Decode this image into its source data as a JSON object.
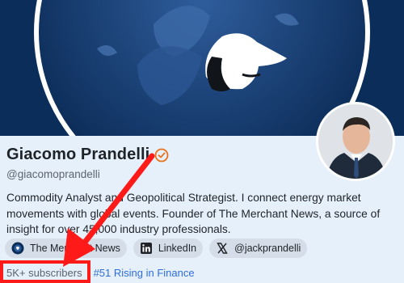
{
  "profile": {
    "name": "Giacomo Prandelli",
    "handle": "@giacomoprandelli",
    "bio": "Commodity Analyst and Geopolitical Strategist. I connect energy market movements with global events. Founder of The Merchant News, a source of insight for over 45,000 industry professionals."
  },
  "links": [
    {
      "label": "The Merchant News",
      "icon": "merchant-news-logo-icon"
    },
    {
      "label": "LinkedIn",
      "icon": "linkedin-icon"
    },
    {
      "label": "@jackprandelli",
      "icon": "x-icon"
    }
  ],
  "stats": {
    "subscribers": "5K+ subscribers",
    "ranking": "#51 Rising in Finance"
  },
  "colors": {
    "banner": "#0a2e5c",
    "verified": "#e8731a",
    "link": "#2f6ed8",
    "annotation": "#ff1a1a"
  }
}
